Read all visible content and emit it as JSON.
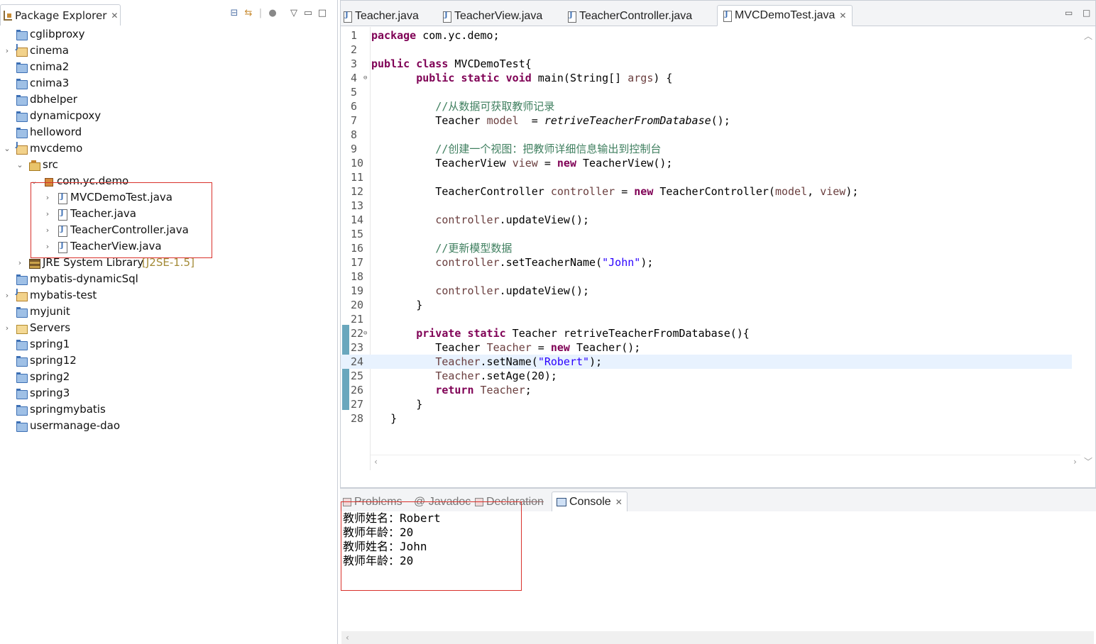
{
  "package_explorer": {
    "title": "Package Explorer",
    "close": "✕",
    "toolbar": [
      "collapse-all",
      "link-with-editor",
      "focus",
      "view-menu",
      "minimize",
      "maximize"
    ],
    "items": [
      {
        "label": "cglibproxy",
        "icon": "project-icon",
        "expandable": false
      },
      {
        "label": "cinema",
        "icon": "java-project-icon",
        "expandable": true,
        "expanded": false
      },
      {
        "label": "cnima2",
        "icon": "project-icon",
        "expandable": false
      },
      {
        "label": "cnima3",
        "icon": "project-icon",
        "expandable": false
      },
      {
        "label": "dbhelper",
        "icon": "project-icon",
        "expandable": false
      },
      {
        "label": "dynamicpoxy",
        "icon": "project-icon",
        "expandable": false
      },
      {
        "label": "helloword",
        "icon": "project-icon",
        "expandable": false
      },
      {
        "label": "mvcdemo",
        "icon": "java-project-icon",
        "expandable": true,
        "expanded": true
      },
      {
        "label": "src",
        "icon": "src-folder-icon",
        "expandable": true,
        "expanded": true
      },
      {
        "label": "com.yc.demo",
        "icon": "package-icon",
        "expandable": true,
        "expanded": true
      },
      {
        "label": "MVCDemoTest.java",
        "icon": "java-file-icon",
        "expandable": true,
        "expanded": false
      },
      {
        "label": "Teacher.java",
        "icon": "java-file-icon",
        "expandable": true,
        "expanded": false
      },
      {
        "label": "TeacherController.java",
        "icon": "java-file-icon",
        "expandable": true,
        "expanded": false
      },
      {
        "label": "TeacherView.java",
        "icon": "java-file-icon",
        "expandable": true,
        "expanded": false
      },
      {
        "label": "JRE System Library",
        "decoration": "[J2SE-1.5]",
        "icon": "library-icon",
        "expandable": true,
        "expanded": false
      },
      {
        "label": "mybatis-dynamicSql",
        "icon": "project-icon",
        "expandable": false
      },
      {
        "label": "mybatis-test",
        "icon": "java-project-icon",
        "expandable": true,
        "expanded": false
      },
      {
        "label": "myjunit",
        "icon": "project-icon",
        "expandable": false
      },
      {
        "label": "Servers",
        "icon": "folder-open-icon",
        "expandable": true,
        "expanded": false
      },
      {
        "label": "spring1",
        "icon": "project-icon",
        "expandable": false
      },
      {
        "label": "spring12",
        "icon": "project-icon",
        "expandable": false
      },
      {
        "label": "spring2",
        "icon": "project-icon",
        "expandable": false
      },
      {
        "label": "spring3",
        "icon": "project-icon",
        "expandable": false
      },
      {
        "label": "springmybatis",
        "icon": "project-icon",
        "expandable": false
      },
      {
        "label": "usermanage-dao",
        "icon": "project-icon",
        "expandable": false
      }
    ]
  },
  "editor": {
    "tabs": [
      {
        "label": "Teacher.java",
        "active": false
      },
      {
        "label": "TeacherView.java",
        "active": false
      },
      {
        "label": "TeacherController.java",
        "active": false
      },
      {
        "label": "MVCDemoTest.java",
        "active": true
      }
    ],
    "close": "✕",
    "current_line": 24,
    "lines": [
      {
        "n": "1",
        "text": "package com.yc.demo;"
      },
      {
        "n": "2",
        "text": ""
      },
      {
        "n": "3",
        "text": "public class MVCDemoTest{"
      },
      {
        "n": "4",
        "text": "       public static void main(String[] args) {",
        "fold": true
      },
      {
        "n": "5",
        "text": ""
      },
      {
        "n": "6",
        "text": "          //从数据可获取教师记录"
      },
      {
        "n": "7",
        "text": "          Teacher model  = retriveTeacherFromDatabase();"
      },
      {
        "n": "8",
        "text": ""
      },
      {
        "n": "9",
        "text": "          //创建一个视图：把教师详细信息输出到控制台"
      },
      {
        "n": "10",
        "text": "          TeacherView view = new TeacherView();"
      },
      {
        "n": "11",
        "text": ""
      },
      {
        "n": "12",
        "text": "          TeacherController controller = new TeacherController(model, view);"
      },
      {
        "n": "13",
        "text": ""
      },
      {
        "n": "14",
        "text": "          controller.updateView();"
      },
      {
        "n": "15",
        "text": ""
      },
      {
        "n": "16",
        "text": "          //更新模型数据"
      },
      {
        "n": "17",
        "text": "          controller.setTeacherName(\"John\");"
      },
      {
        "n": "18",
        "text": ""
      },
      {
        "n": "19",
        "text": "          controller.updateView();"
      },
      {
        "n": "20",
        "text": "       }"
      },
      {
        "n": "21",
        "text": ""
      },
      {
        "n": "22",
        "text": "       private static Teacher retriveTeacherFromDatabase(){",
        "fold": true
      },
      {
        "n": "23",
        "text": "          Teacher Teacher = new Teacher();"
      },
      {
        "n": "24",
        "text": "          Teacher.setName(\"Robert\");"
      },
      {
        "n": "25",
        "text": "          Teacher.setAge(20);"
      },
      {
        "n": "26",
        "text": "          return Teacher;"
      },
      {
        "n": "27",
        "text": "       }"
      },
      {
        "n": "28",
        "text": "   }"
      }
    ]
  },
  "bottom_panel": {
    "tabs": [
      {
        "label": "Problems",
        "active": false
      },
      {
        "label": "@ Javadoc",
        "active": false
      },
      {
        "label": "Declaration",
        "active": false
      },
      {
        "label": "Console",
        "active": true
      }
    ],
    "close": "✕",
    "console_output": [
      "教师姓名：Robert",
      "教师年龄：20",
      "教师姓名：John",
      "教师年龄：20"
    ]
  },
  "colors": {
    "keyword": "#7f0055",
    "comment": "#3f7f5f",
    "string": "#2a00ff",
    "field": "#6a3e3e",
    "highlight_box": "#d9312b",
    "current_line": "#e8f2fe"
  }
}
